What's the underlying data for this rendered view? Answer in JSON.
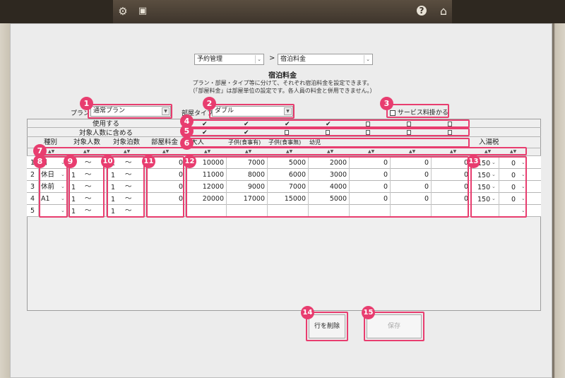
{
  "toolbar": {
    "icons": [
      "gear-icon",
      "printer-icon",
      "help-icon",
      "home-icon"
    ],
    "icon_glyphs": [
      "⚙",
      "🖨",
      "?",
      "⌂"
    ]
  },
  "breadcrumb": {
    "first": "予約管理",
    "separator": ">",
    "second": "宿泊料金"
  },
  "page": {
    "title": "宿泊料金",
    "desc1": "プラン・部屋・タイプ等に分けて、それぞれ宿泊料金を設定できます。",
    "desc2": "（「部屋料金」は部屋単位の設定です。各人員の料金と併用できません。）"
  },
  "filters": {
    "plan_label": "プラン",
    "plan_value": "通常プラン",
    "room_type_label": "部屋タイプ",
    "room_type_value": "ダブル",
    "service_charge_label": "サービス料掛かる"
  },
  "grid": {
    "use_label": "使用する",
    "include_label": "対象人数に含める",
    "headers": [
      "種別",
      "対象人数",
      "対象泊数",
      "部屋料金",
      "大人",
      "子供(食事有)",
      "子供(食事無)",
      "幼児",
      "入湯税"
    ],
    "row_numbers": [
      "1",
      "2",
      "3",
      "4",
      "5"
    ],
    "rows": [
      {
        "type": "日",
        "persons": "1",
        "nights": "1",
        "room": "0",
        "adult": "10000",
        "child_meal": "7000",
        "child_nomeal": "5000",
        "infant": "2000",
        "c5": "0",
        "c6": "0",
        "c7": "0",
        "tax": "150",
        "tax2": "0"
      },
      {
        "type": "休日",
        "persons": "1",
        "nights": "1",
        "room": "0",
        "adult": "11000",
        "child_meal": "8000",
        "child_nomeal": "6000",
        "infant": "3000",
        "c5": "0",
        "c6": "0",
        "c7": "0",
        "tax": "150",
        "tax2": "0"
      },
      {
        "type": "休前",
        "persons": "1",
        "nights": "1",
        "room": "0",
        "adult": "12000",
        "child_meal": "9000",
        "child_nomeal": "7000",
        "infant": "4000",
        "c5": "0",
        "c6": "0",
        "c7": "0",
        "tax": "150",
        "tax2": "0"
      },
      {
        "type": "A1",
        "persons": "1",
        "nights": "1",
        "room": "0",
        "adult": "20000",
        "child_meal": "17000",
        "child_nomeal": "15000",
        "infant": "5000",
        "c5": "0",
        "c6": "0",
        "c7": "0",
        "tax": "150",
        "tax2": "0"
      },
      {
        "type": "",
        "persons": "1",
        "nights": "1",
        "room": "",
        "adult": "",
        "child_meal": "",
        "child_nomeal": "",
        "infant": "",
        "c5": "",
        "c6": "",
        "c7": "",
        "tax": "",
        "tax2": ""
      }
    ],
    "tilde": "〜",
    "sort_arrows": "▲▼"
  },
  "buttons": {
    "delete_row": "行を削除",
    "save": "保存"
  },
  "annotations": [
    "1",
    "2",
    "3",
    "4",
    "5",
    "6",
    "7",
    "8",
    "9",
    "10",
    "11",
    "12",
    "13",
    "14",
    "15"
  ],
  "accent_color": "#e83d6f"
}
